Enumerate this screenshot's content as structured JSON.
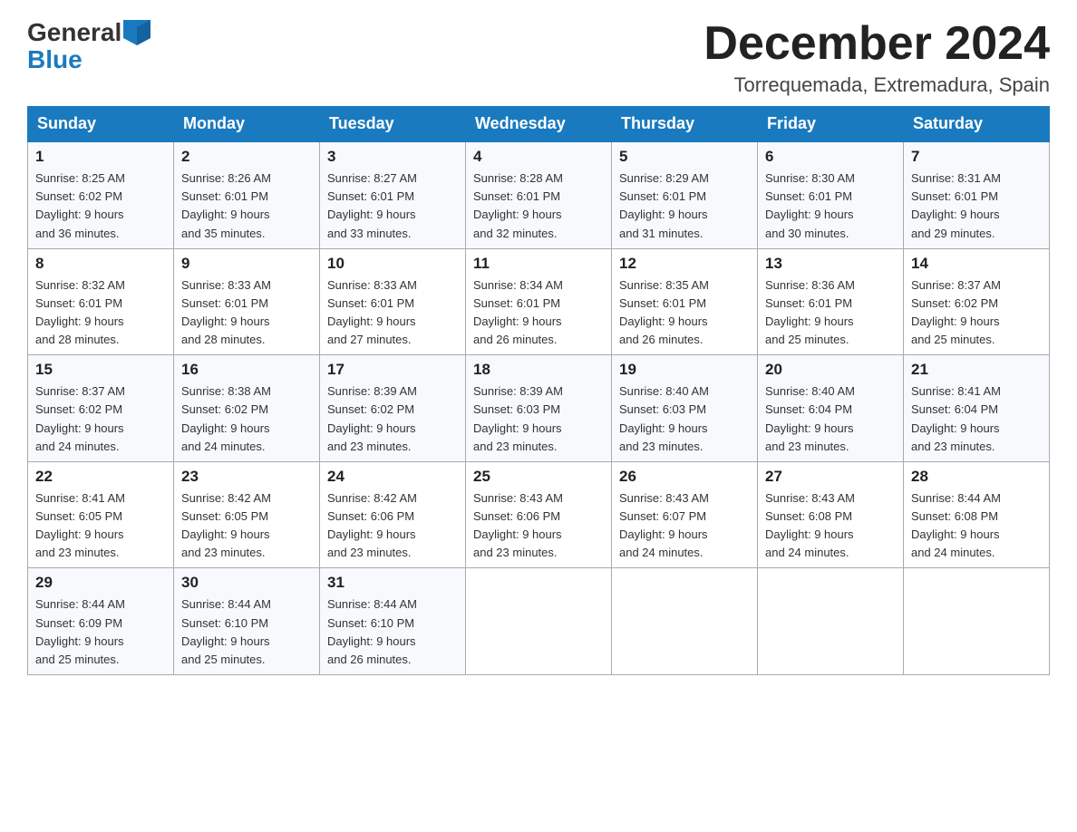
{
  "header": {
    "logo_general": "General",
    "logo_blue": "Blue",
    "month_title": "December 2024",
    "location": "Torrequemada, Extremadura, Spain"
  },
  "days_of_week": [
    "Sunday",
    "Monday",
    "Tuesday",
    "Wednesday",
    "Thursday",
    "Friday",
    "Saturday"
  ],
  "weeks": [
    [
      {
        "num": "1",
        "sunrise": "8:25 AM",
        "sunset": "6:02 PM",
        "daylight": "9 hours and 36 minutes."
      },
      {
        "num": "2",
        "sunrise": "8:26 AM",
        "sunset": "6:01 PM",
        "daylight": "9 hours and 35 minutes."
      },
      {
        "num": "3",
        "sunrise": "8:27 AM",
        "sunset": "6:01 PM",
        "daylight": "9 hours and 33 minutes."
      },
      {
        "num": "4",
        "sunrise": "8:28 AM",
        "sunset": "6:01 PM",
        "daylight": "9 hours and 32 minutes."
      },
      {
        "num": "5",
        "sunrise": "8:29 AM",
        "sunset": "6:01 PM",
        "daylight": "9 hours and 31 minutes."
      },
      {
        "num": "6",
        "sunrise": "8:30 AM",
        "sunset": "6:01 PM",
        "daylight": "9 hours and 30 minutes."
      },
      {
        "num": "7",
        "sunrise": "8:31 AM",
        "sunset": "6:01 PM",
        "daylight": "9 hours and 29 minutes."
      }
    ],
    [
      {
        "num": "8",
        "sunrise": "8:32 AM",
        "sunset": "6:01 PM",
        "daylight": "9 hours and 28 minutes."
      },
      {
        "num": "9",
        "sunrise": "8:33 AM",
        "sunset": "6:01 PM",
        "daylight": "9 hours and 28 minutes."
      },
      {
        "num": "10",
        "sunrise": "8:33 AM",
        "sunset": "6:01 PM",
        "daylight": "9 hours and 27 minutes."
      },
      {
        "num": "11",
        "sunrise": "8:34 AM",
        "sunset": "6:01 PM",
        "daylight": "9 hours and 26 minutes."
      },
      {
        "num": "12",
        "sunrise": "8:35 AM",
        "sunset": "6:01 PM",
        "daylight": "9 hours and 26 minutes."
      },
      {
        "num": "13",
        "sunrise": "8:36 AM",
        "sunset": "6:01 PM",
        "daylight": "9 hours and 25 minutes."
      },
      {
        "num": "14",
        "sunrise": "8:37 AM",
        "sunset": "6:02 PM",
        "daylight": "9 hours and 25 minutes."
      }
    ],
    [
      {
        "num": "15",
        "sunrise": "8:37 AM",
        "sunset": "6:02 PM",
        "daylight": "9 hours and 24 minutes."
      },
      {
        "num": "16",
        "sunrise": "8:38 AM",
        "sunset": "6:02 PM",
        "daylight": "9 hours and 24 minutes."
      },
      {
        "num": "17",
        "sunrise": "8:39 AM",
        "sunset": "6:02 PM",
        "daylight": "9 hours and 23 minutes."
      },
      {
        "num": "18",
        "sunrise": "8:39 AM",
        "sunset": "6:03 PM",
        "daylight": "9 hours and 23 minutes."
      },
      {
        "num": "19",
        "sunrise": "8:40 AM",
        "sunset": "6:03 PM",
        "daylight": "9 hours and 23 minutes."
      },
      {
        "num": "20",
        "sunrise": "8:40 AM",
        "sunset": "6:04 PM",
        "daylight": "9 hours and 23 minutes."
      },
      {
        "num": "21",
        "sunrise": "8:41 AM",
        "sunset": "6:04 PM",
        "daylight": "9 hours and 23 minutes."
      }
    ],
    [
      {
        "num": "22",
        "sunrise": "8:41 AM",
        "sunset": "6:05 PM",
        "daylight": "9 hours and 23 minutes."
      },
      {
        "num": "23",
        "sunrise": "8:42 AM",
        "sunset": "6:05 PM",
        "daylight": "9 hours and 23 minutes."
      },
      {
        "num": "24",
        "sunrise": "8:42 AM",
        "sunset": "6:06 PM",
        "daylight": "9 hours and 23 minutes."
      },
      {
        "num": "25",
        "sunrise": "8:43 AM",
        "sunset": "6:06 PM",
        "daylight": "9 hours and 23 minutes."
      },
      {
        "num": "26",
        "sunrise": "8:43 AM",
        "sunset": "6:07 PM",
        "daylight": "9 hours and 24 minutes."
      },
      {
        "num": "27",
        "sunrise": "8:43 AM",
        "sunset": "6:08 PM",
        "daylight": "9 hours and 24 minutes."
      },
      {
        "num": "28",
        "sunrise": "8:44 AM",
        "sunset": "6:08 PM",
        "daylight": "9 hours and 24 minutes."
      }
    ],
    [
      {
        "num": "29",
        "sunrise": "8:44 AM",
        "sunset": "6:09 PM",
        "daylight": "9 hours and 25 minutes."
      },
      {
        "num": "30",
        "sunrise": "8:44 AM",
        "sunset": "6:10 PM",
        "daylight": "9 hours and 25 minutes."
      },
      {
        "num": "31",
        "sunrise": "8:44 AM",
        "sunset": "6:10 PM",
        "daylight": "9 hours and 26 minutes."
      },
      null,
      null,
      null,
      null
    ]
  ],
  "labels": {
    "sunrise": "Sunrise:",
    "sunset": "Sunset:",
    "daylight": "Daylight:"
  }
}
